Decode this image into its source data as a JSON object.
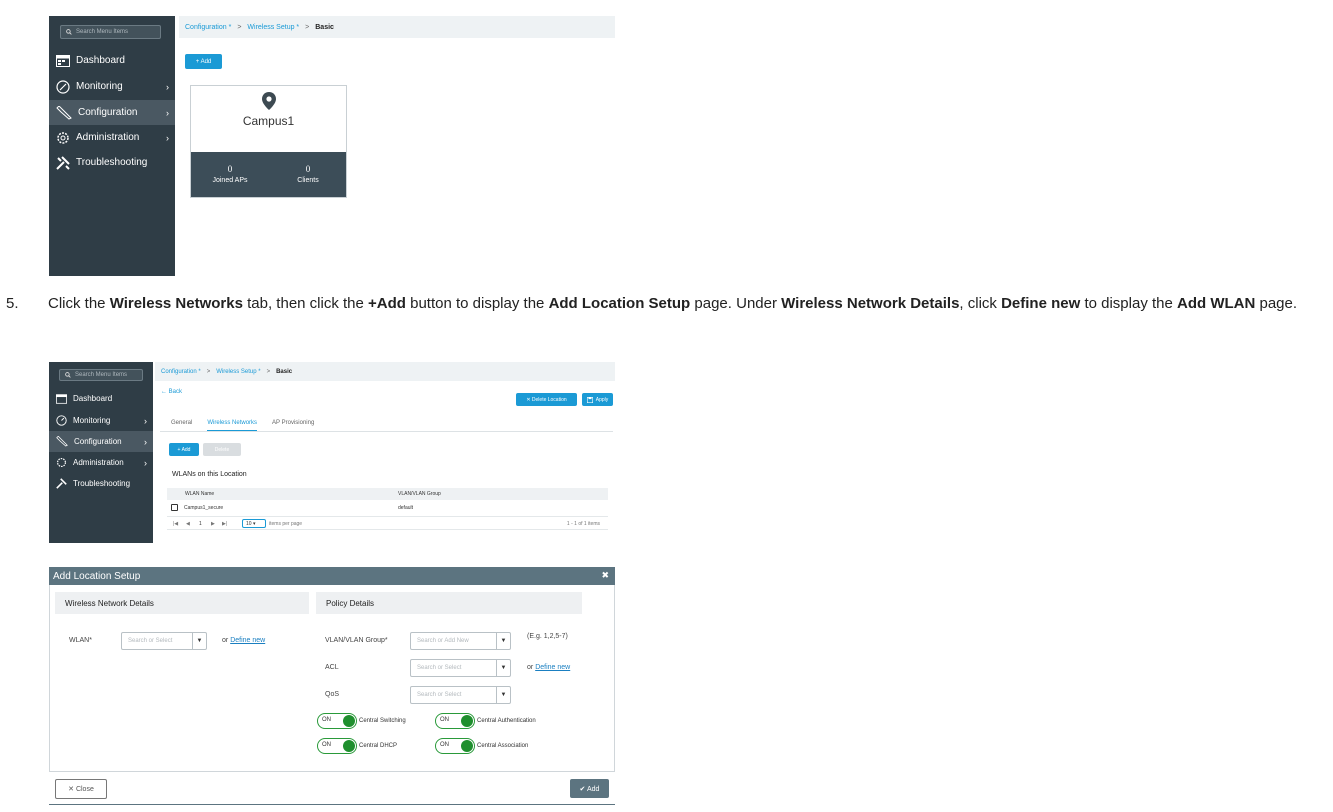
{
  "shot1": {
    "search_placeholder": "Search Menu Items",
    "menu": [
      {
        "label": "Dashboard",
        "icon": "dashboard-icon"
      },
      {
        "label": "Monitoring",
        "icon": "monitoring-icon"
      },
      {
        "label": "Configuration",
        "icon": "wrench-icon"
      },
      {
        "label": "Administration",
        "icon": "gear-icon"
      },
      {
        "label": "Troubleshooting",
        "icon": "tools-icon"
      }
    ],
    "breadcrumb": {
      "item1": "Configuration *",
      "item2": "Wireless Setup *",
      "current": "Basic",
      "sep": ">"
    },
    "add_button": "+ Add",
    "card": {
      "name": "Campus1",
      "joined_aps_value": "0",
      "joined_aps_label": "Joined APs",
      "clients_value": "0",
      "clients_label": "Clients"
    }
  },
  "instruction": {
    "number": "5.",
    "t1": "Click the ",
    "b1": "Wireless Networks",
    "t2": " tab, then click the ",
    "b2": "+Add",
    "t3": " button to display the ",
    "b3": "Add Location Setup",
    "t4": " page. Under ",
    "b4": "Wireless Network Details",
    "t5": ", click ",
    "b5": "Define new",
    "t6": " to display the ",
    "b6": "Add WLAN",
    "t7": " page."
  },
  "shot2": {
    "search_placeholder": "Search Menu Items",
    "menu": [
      "Dashboard",
      "Monitoring",
      "Configuration",
      "Administration",
      "Troubleshooting"
    ],
    "breadcrumb": {
      "item1": "Configuration *",
      "item2": "Wireless Setup *",
      "current": "Basic",
      "sep": ">"
    },
    "back": "← Back",
    "delete_location": "✕ Delete Location",
    "apply": "Apply",
    "tabs": [
      "General",
      "Wireless Networks",
      "AP Provisioning"
    ],
    "add": "+ Add",
    "delete": "Delete",
    "section_title": "WLANs on this Location",
    "columns": [
      "WLAN Name",
      "VLAN/VLAN Group"
    ],
    "rows": [
      {
        "wlan": "Campus1_secure",
        "vlan": "default"
      }
    ],
    "pager": {
      "first": "|◀",
      "prev": "◀",
      "page": "1",
      "next": "▶",
      "last": "▶|",
      "per_page": "10",
      "per_page_label": "items per page",
      "range": "1 - 1 of 1 items"
    }
  },
  "modal": {
    "title": "Add Location Setup",
    "close_x": "✖",
    "left_section": "Wireless Network Details",
    "right_section": "Policy Details",
    "wlan_label": "WLAN*",
    "wlan_placeholder": "Search or Select",
    "or": "or",
    "define_new": "Define new",
    "vlan_label": "VLAN/VLAN Group*",
    "vlan_placeholder": "Search or Add New",
    "vlan_hint": "(E.g. 1,2,5-7)",
    "acl_label": "ACL",
    "acl_placeholder": "Search or Select",
    "qos_label": "QoS",
    "qos_placeholder": "Search or Select",
    "toggles": [
      {
        "state": "ON",
        "label": "Central Switching",
        "on": true
      },
      {
        "state": "ON",
        "label": "Central Authentication",
        "on": true
      },
      {
        "state": "ON",
        "label": "Central DHCP",
        "on": true
      },
      {
        "state": "ON",
        "label": "Central Association",
        "on": true
      }
    ],
    "close_button": "✕ Close",
    "add_button": "✔ Add"
  },
  "colors": {
    "sidebar": "#2f3d46",
    "accent": "#1b9ad5",
    "modal_header": "#5c7480",
    "toggle_on": "#1f8f2e"
  }
}
